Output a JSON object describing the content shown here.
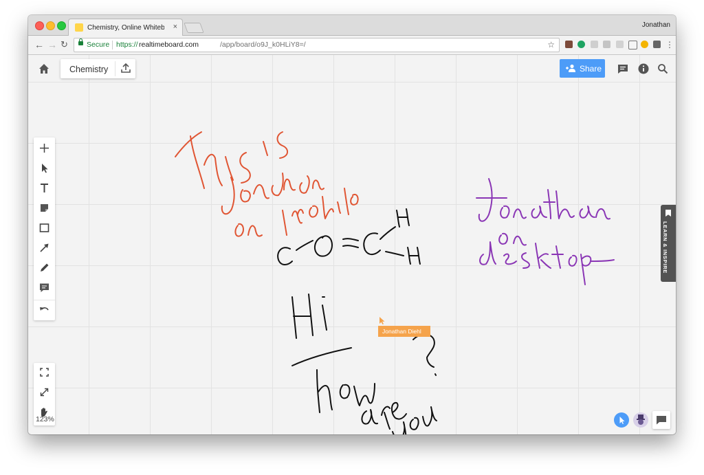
{
  "browser": {
    "tab_title": "Chemistry, Online Whiteboard",
    "tab_close": "×",
    "profile_name": "Jonathan",
    "secure_label": "Secure",
    "url_scheme": "https://",
    "url_host": "realtimeboard.com",
    "url_path": "/app/board/o9J_k0HLiY8=/"
  },
  "board": {
    "name": "Chemistry",
    "share_label": "Share",
    "zoom": "123%",
    "learn_label": "LEARN & INSPIRE",
    "collaborator_cursor": "Jonathan Diehl",
    "colors": {
      "share_button": "#4d9cf8",
      "ink_mobile": "#e05533",
      "ink_desktop": "#8a36b5",
      "ink_black": "#111111",
      "cursor_tag": "#f5a34b"
    }
  },
  "toolbar_icons": [
    "plus-icon",
    "select-arrow-icon",
    "text-icon",
    "sticky-note-icon",
    "rectangle-icon",
    "connector-arrow-icon",
    "pen-icon",
    "comment-icon",
    "undo-icon"
  ],
  "view_icons": [
    "fit-screen-icon",
    "fullscreen-icon",
    "hand-pan-icon"
  ]
}
